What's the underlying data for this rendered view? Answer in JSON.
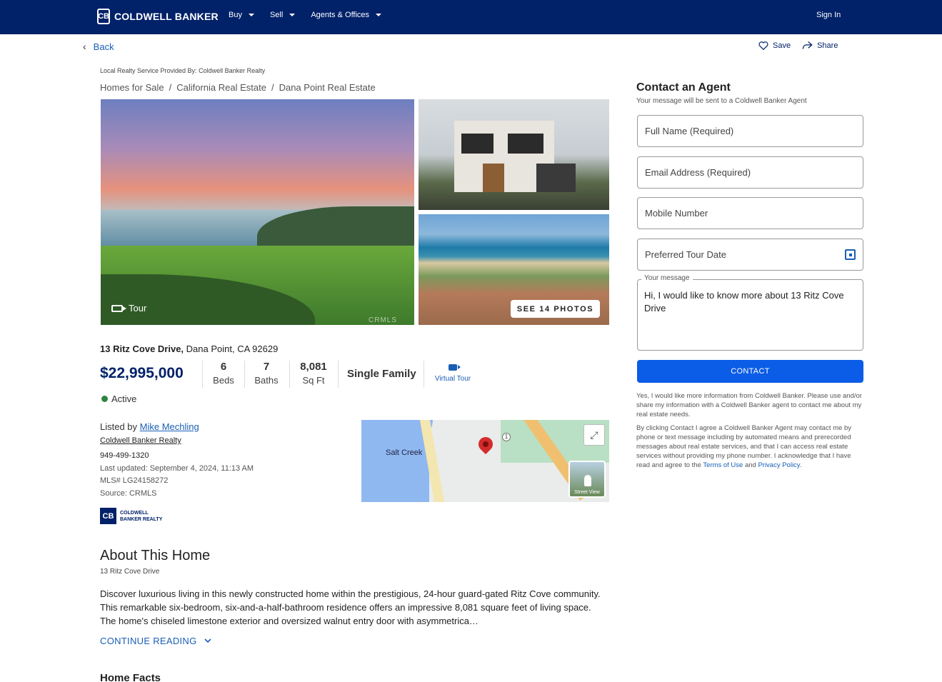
{
  "header": {
    "logo_text": "COLDWELL BANKER",
    "nav": [
      {
        "label": "Buy"
      },
      {
        "label": "Sell"
      },
      {
        "label": "Agents & Offices"
      }
    ],
    "signin": "Sign In"
  },
  "toolbar": {
    "back": "Back",
    "save": "Save",
    "share": "Share"
  },
  "provider": "Local Realty Service Provided By: Coldwell Banker Realty",
  "breadcrumbs": [
    "Homes for Sale",
    "California Real Estate",
    "Dana Point Real Estate"
  ],
  "photos": {
    "tour_label": "Tour",
    "watermark": "CRMLS",
    "see_photos": "SEE 14 PHOTOS"
  },
  "listing": {
    "street": "13 Ritz Cove Drive,",
    "city_line": "Dana Point, CA 92629",
    "price": "$22,995,000",
    "beds": "6",
    "beds_label": "Beds",
    "baths": "7",
    "baths_label": "Baths",
    "sqft": "8,081",
    "sqft_label": "Sq Ft",
    "type": "Single Family",
    "virtual_tour": "Virtual Tour",
    "status": "Active",
    "status_color": "#2e8540",
    "listed_by_prefix": "Listed by",
    "agent": "Mike Mechling",
    "brokerage": "Coldwell Banker Realty",
    "phone": "949-499-1320",
    "updated": "Last updated: September 4, 2024, 11:13 AM",
    "mls": "MLS# LG24158272",
    "source": "Source: CRMLS",
    "brand_logo_text": "COLDWELL BANKER REALTY"
  },
  "map": {
    "label_creek": "Salt Creek",
    "road_shield": "1",
    "street_view": "Street View"
  },
  "about": {
    "heading": "About This Home",
    "sub": "13 Ritz Cove Drive",
    "body": "Discover luxurious living in this newly constructed home within the prestigious, 24-hour guard-gated Ritz Cove community. This remarkable six-bedroom, six-and-a-half-bathroom residence offers an impressive 8,081 square feet of living space. The home's chiseled limestone exterior and oversized walnut entry door with asymmetrica…",
    "continue": "CONTINUE READING",
    "home_facts": "Home Facts"
  },
  "contact": {
    "heading": "Contact an Agent",
    "sub": "Your message will be sent to a Coldwell Banker Agent",
    "full_name": "Full Name (Required)",
    "email": "Email Address (Required)",
    "mobile": "Mobile Number",
    "tour_date": "Preferred Tour Date",
    "message_label": "Your message",
    "message": "Hi, I would like to know more about 13 Ritz Cove Drive",
    "button": "CONTACT",
    "legal1": "Yes, I would like more information from Coldwell Banker. Please use and/or share my information with a Coldwell Banker agent to contact me about my real estate needs.",
    "legal2_a": "By clicking Contact I agree a Coldwell Banker Agent may contact me by phone or text message including by automated means and prerecorded messages about real estate services, and that I can access real estate services without providing my phone number. I acknowledge that I have read and agree to the",
    "terms": "Terms of Use",
    "and": "and",
    "privacy": "Privacy Policy"
  },
  "colors": {
    "brand_navy": "#012169",
    "link_blue": "#1a5fb4",
    "cta_blue": "#0b5ce6"
  }
}
